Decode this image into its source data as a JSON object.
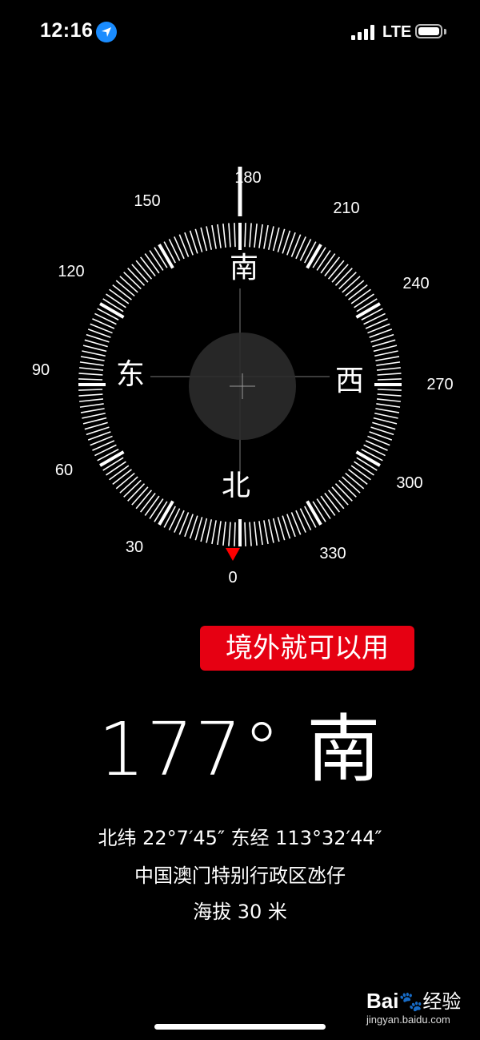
{
  "status_bar": {
    "time": "12:16",
    "location_icon": "location-arrow-icon",
    "network": "LTE",
    "battery_level": 1.0
  },
  "compass": {
    "heading_degrees": 177,
    "cardinals": {
      "north": "北",
      "south": "南",
      "east": "东",
      "west": "西"
    },
    "degree_labels": [
      "0",
      "30",
      "60",
      "90",
      "120",
      "150",
      "180",
      "210",
      "240",
      "270",
      "300",
      "330"
    ],
    "accent_color": "#ff0000"
  },
  "stamp": {
    "text": "境外就可以用",
    "color": "#e60012"
  },
  "heading_readout": {
    "degrees": "177°",
    "direction": "南"
  },
  "location": {
    "coordinates": "北纬 22°7′45″  东经 113°32′44″",
    "region": "中国澳门特别行政区氹仔",
    "altitude": "海拔 30 米"
  },
  "watermark": {
    "logo": "Bai",
    "logo_suffix": "经验",
    "url": "jingyan.baidu.com"
  }
}
